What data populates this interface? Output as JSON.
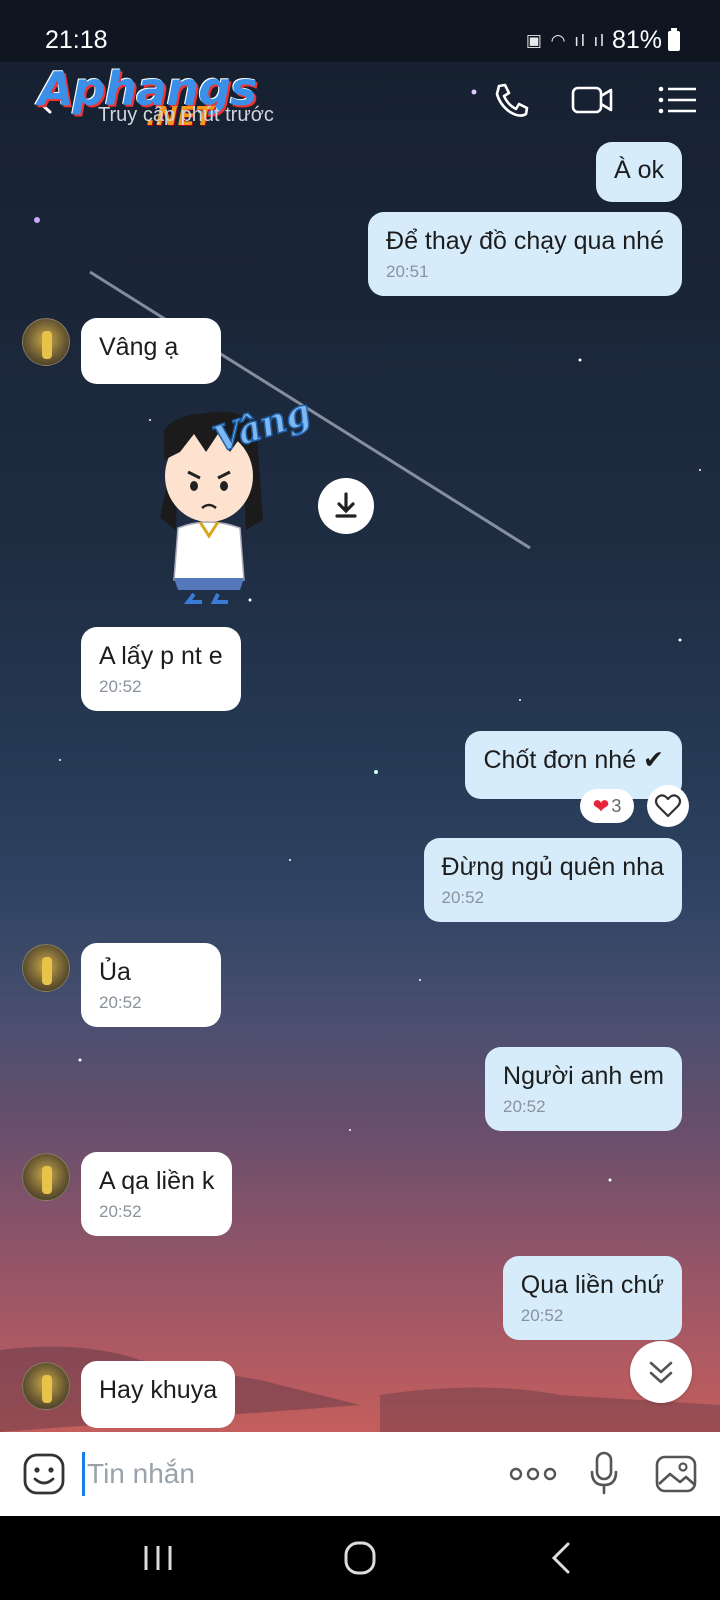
{
  "status_bar": {
    "time": "21:18",
    "battery": "81%"
  },
  "header": {
    "watermark_main": "Aphangs",
    "watermark_net": ".NET",
    "subtitle": "Truy cập phút trước"
  },
  "messages": [
    {
      "id": "m1",
      "sender": "me",
      "text": "À ok",
      "time": ""
    },
    {
      "id": "m2",
      "sender": "me",
      "text": "Để thay đồ chạy qua nhé",
      "time": "20:51"
    },
    {
      "id": "m3",
      "sender": "other",
      "text": "Vâng ạ",
      "time": ""
    },
    {
      "id": "m4",
      "sender": "other",
      "type": "sticker",
      "text": "Vâng"
    },
    {
      "id": "m5",
      "sender": "other",
      "text": "A lấy p nt e",
      "time": "20:52"
    },
    {
      "id": "m6",
      "sender": "me",
      "text": "Chốt đơn nhé ✔",
      "time": "",
      "reaction_count": "3"
    },
    {
      "id": "m7",
      "sender": "me",
      "text": "Đừng ngủ quên nha",
      "time": "20:52"
    },
    {
      "id": "m8",
      "sender": "other",
      "text": "Ủa",
      "time": "20:52"
    },
    {
      "id": "m9",
      "sender": "me",
      "text": "Người anh em",
      "time": "20:52"
    },
    {
      "id": "m10",
      "sender": "other",
      "text": "A qa liền k",
      "time": "20:52"
    },
    {
      "id": "m11",
      "sender": "me",
      "text": "Qua liền chứ",
      "time": "20:52"
    },
    {
      "id": "m12",
      "sender": "other",
      "text": "Hay khuya",
      "time": ""
    }
  ],
  "input": {
    "placeholder": "Tin nhắn"
  },
  "colors": {
    "my_bubble": "#d6ecfb",
    "their_bubble": "#ffffff",
    "accent": "#1a7ee8"
  }
}
